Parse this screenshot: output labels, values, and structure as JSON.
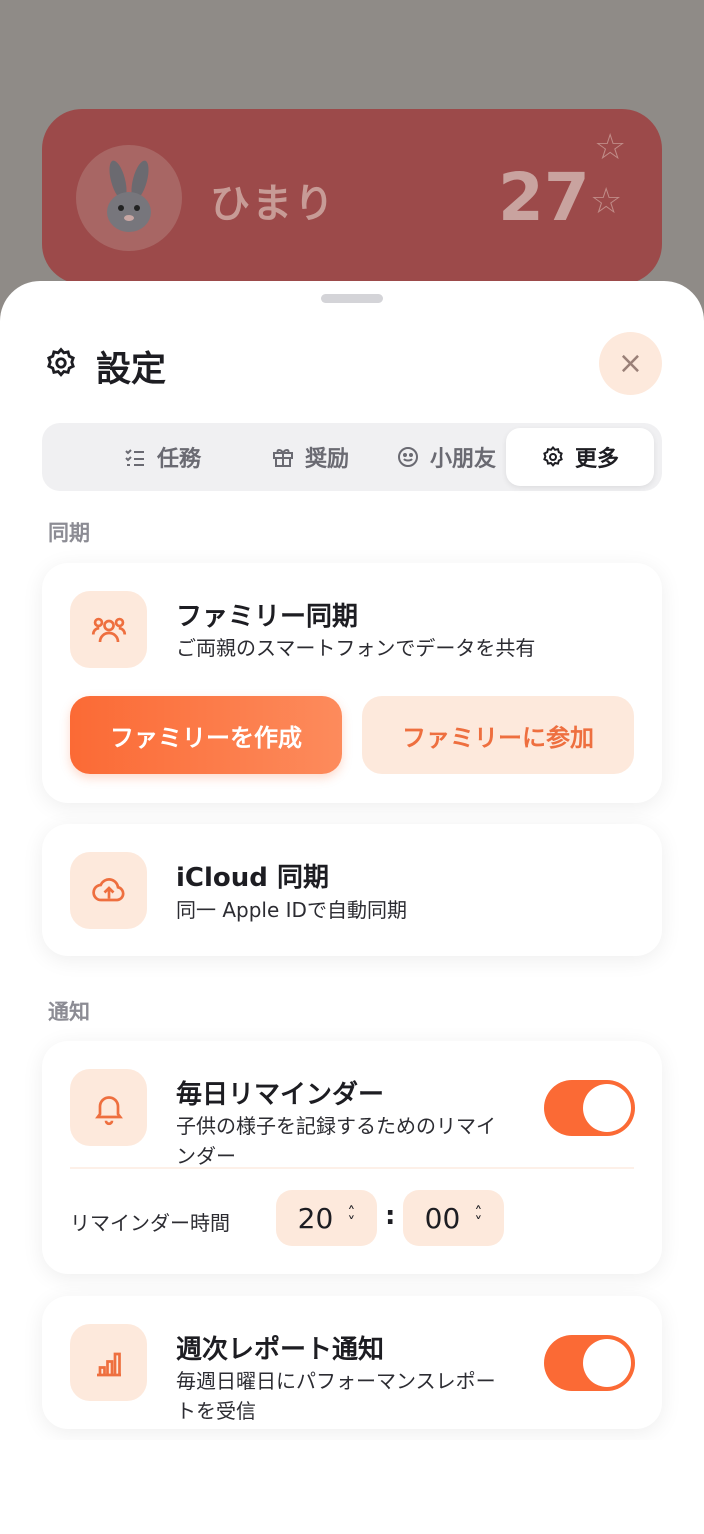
{
  "background": {
    "child_name": "ひまり",
    "star_count": "27"
  },
  "sheet": {
    "title": "設定",
    "close_label": "×"
  },
  "tabs": [
    {
      "label": "任務",
      "icon": "checklist-icon",
      "active": false
    },
    {
      "label": "奨励",
      "icon": "gift-icon",
      "active": false
    },
    {
      "label": "小朋友",
      "icon": "smile-icon",
      "active": false
    },
    {
      "label": "更多",
      "icon": "gear-icon",
      "active": true
    }
  ],
  "sync": {
    "section_label": "同期",
    "family": {
      "title": "ファミリー同期",
      "subtitle": "ご両親のスマートフォンでデータを共有",
      "create_label": "ファミリーを作成",
      "join_label": "ファミリーに参加"
    },
    "icloud": {
      "title": "iCloud 同期",
      "subtitle": "同一 Apple IDで自動同期"
    }
  },
  "notify": {
    "section_label": "通知",
    "daily": {
      "title": "毎日リマインダー",
      "subtitle_line1": "子供の様子を記録するためのリマイ",
      "subtitle_line2": "ンダー",
      "enabled": true,
      "time_label": "リマインダー時間",
      "hour": "20",
      "minute": "00",
      "separator": ":"
    },
    "weekly": {
      "title": "週次レポート通知",
      "subtitle_line1": "毎週日曜日にパフォーマンスレポー",
      "subtitle_line2": "トを受信",
      "enabled": true
    }
  },
  "colors": {
    "accent": "#fb6a35",
    "accent_soft": "#fde9dc"
  }
}
